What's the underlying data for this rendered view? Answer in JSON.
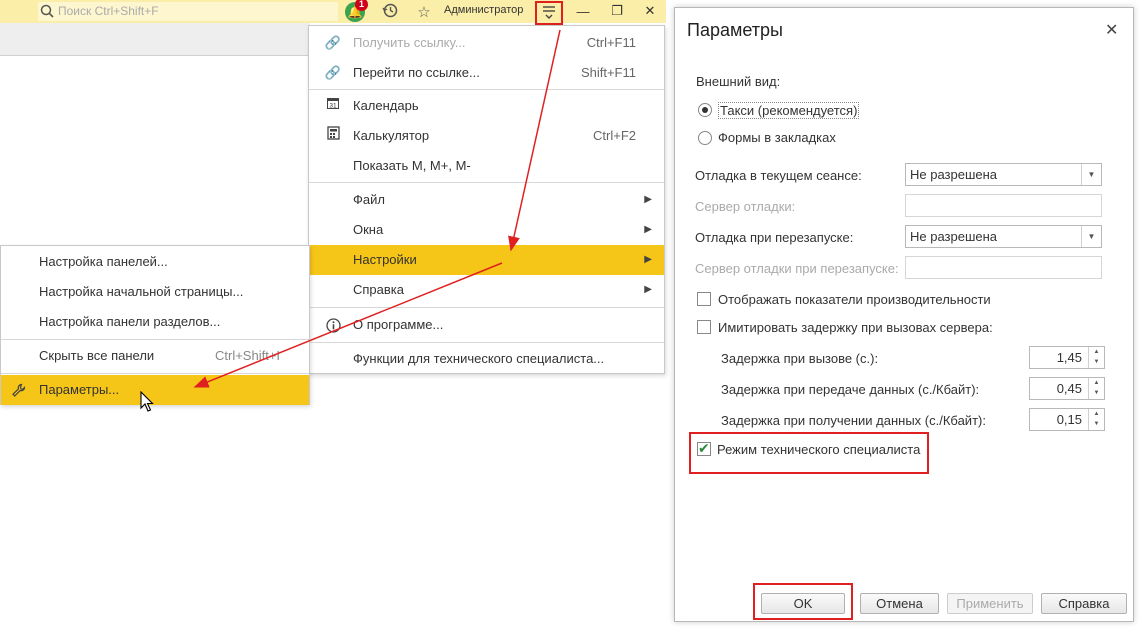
{
  "topbar": {
    "search_placeholder": "Поиск Ctrl+Shift+F",
    "notification_count": "1",
    "user_name": "Администратор"
  },
  "main_menu": {
    "get_link": {
      "label": "Получить ссылку...",
      "shortcut": "Ctrl+F11"
    },
    "go_to_link": {
      "label": "Перейти по ссылке...",
      "shortcut": "Shift+F11"
    },
    "calendar": {
      "label": "Календарь",
      "icon_text": "31"
    },
    "calculator": {
      "label": "Калькулятор",
      "shortcut": "Ctrl+F2"
    },
    "show_m": {
      "label": "Показать M, M+, M-"
    },
    "file": {
      "label": "Файл"
    },
    "windows": {
      "label": "Окна"
    },
    "settings": {
      "label": "Настройки"
    },
    "help": {
      "label": "Справка"
    },
    "about": {
      "label": "О программе..."
    },
    "tech_functions": {
      "label": "Функции для технического специалиста..."
    }
  },
  "sub_menu": {
    "panels_setup": "Настройка панелей...",
    "home_page_setup": "Настройка начальной страницы...",
    "sections_panel_setup": "Настройка панели разделов...",
    "hide_all_panels": {
      "label": "Скрыть все панели",
      "shortcut": "Ctrl+Shift+I"
    },
    "parameters": "Параметры..."
  },
  "dialog": {
    "title": "Параметры",
    "appearance_label": "Внешний вид:",
    "radio_taxi": "Такси (рекомендуется)",
    "radio_tabs": "Формы в закладках",
    "debug_session_label": "Отладка в текущем сеансе:",
    "debug_session_value": "Не разрешена",
    "debug_server_label": "Сервер отладки:",
    "debug_restart_label": "Отладка при перезапуске:",
    "debug_restart_value": "Не разрешена",
    "debug_server_restart_label": "Сервер отладки при перезапуске:",
    "show_perf_label": "Отображать показатели производительности",
    "simulate_delay_label": "Имитировать задержку при вызовах сервера:",
    "call_delay_label": "Задержка при вызове (с.):",
    "call_delay_value": "1,45",
    "send_delay_label": "Задержка при передаче данных (с./Кбайт):",
    "send_delay_value": "0,45",
    "receive_delay_label": "Задержка при получении данных (с./Кбайт):",
    "receive_delay_value": "0,15",
    "tech_mode_label": "Режим технического специалиста",
    "ok": "OK",
    "cancel": "Отмена",
    "apply": "Применить",
    "help": "Справка"
  },
  "colors": {
    "topbar": "#fbeea8",
    "highlight": "#f5c518",
    "annotation_red": "#e02020",
    "check_green": "#2a8a3a"
  }
}
